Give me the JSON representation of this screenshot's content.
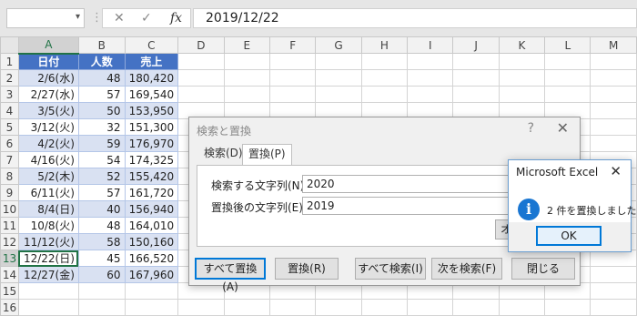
{
  "formula_bar": {
    "namebox_value": "",
    "cancel_icon": "✕",
    "enter_icon": "✓",
    "fx_label": "fx",
    "formula_value": "2019/12/22"
  },
  "grid": {
    "columns": [
      "A",
      "B",
      "C",
      "D",
      "E",
      "F",
      "G",
      "H",
      "I",
      "J",
      "K",
      "L",
      "M"
    ],
    "rows": [
      "1",
      "2",
      "3",
      "4",
      "5",
      "6",
      "7",
      "8",
      "9",
      "10",
      "11",
      "12",
      "13",
      "14",
      "15",
      "16"
    ],
    "headers": [
      "日付",
      "人数",
      "売上"
    ],
    "records": [
      [
        "2/6(水)",
        "48",
        "180,420"
      ],
      [
        "2/27(水)",
        "57",
        "169,540"
      ],
      [
        "3/5(火)",
        "50",
        "153,950"
      ],
      [
        "3/12(火)",
        "32",
        "151,300"
      ],
      [
        "4/2(火)",
        "59",
        "176,970"
      ],
      [
        "4/16(火)",
        "54",
        "174,325"
      ],
      [
        "5/2(木)",
        "52",
        "155,420"
      ],
      [
        "6/11(火)",
        "57",
        "161,720"
      ],
      [
        "8/4(日)",
        "40",
        "156,940"
      ],
      [
        "10/8(火)",
        "48",
        "164,010"
      ],
      [
        "11/12(火)",
        "58",
        "150,160"
      ],
      [
        "12/22(日)",
        "45",
        "166,520"
      ],
      [
        "12/27(金)",
        "60",
        "167,960"
      ]
    ],
    "active_row": "13",
    "active_col": "A",
    "colors": {
      "header_fill": "#4472c4",
      "band_fill": "#d9e1f2",
      "select_green": "#217346"
    }
  },
  "find_replace": {
    "title": "検索と置換",
    "help_icon": "?",
    "close_icon": "✕",
    "tabs": [
      "検索(D)",
      "置換(P)"
    ],
    "find_label": "検索する文字列(N):",
    "find_value": "2020",
    "replace_label": "置換後の文字列(E):",
    "replace_value": "2019",
    "options_button": "オプション(T) >>",
    "buttons": [
      "すべて置換(A)",
      "置換(R)",
      "すべて検索(I)",
      "次を検索(F)",
      "閉じる"
    ]
  },
  "message_box": {
    "title": "Microsoft Excel",
    "close_icon": "✕",
    "icon": "info-icon",
    "icon_glyph": "i",
    "message": "2 件を置換しました。",
    "ok_button": "OK"
  }
}
